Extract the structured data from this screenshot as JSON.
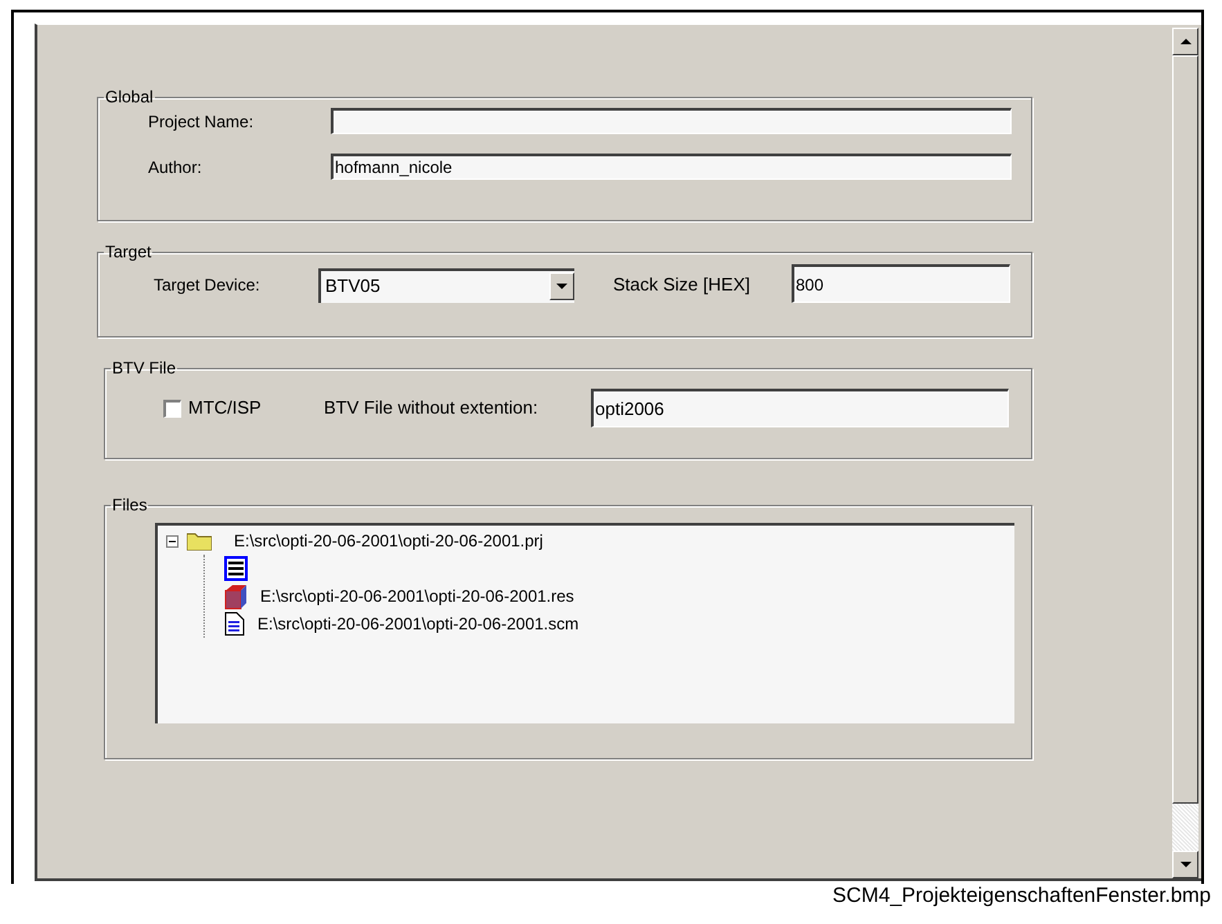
{
  "global": {
    "legend": "Global",
    "project_name": {
      "label": "Project Name:"
    },
    "author": {
      "label": "Author:",
      "value": "hofmann_nicole"
    }
  },
  "target": {
    "legend": "Target",
    "device": {
      "label": "Target Device:",
      "value": "BTV05"
    },
    "stack_size": {
      "label": "Stack Size [HEX]",
      "value": "800"
    }
  },
  "btv_file": {
    "legend": "BTV File",
    "mtc_isp": {
      "label": "MTC/ISP",
      "checked": false
    },
    "file": {
      "label": "BTV File without extention:",
      "value": "opti2006"
    }
  },
  "files": {
    "legend": "Files",
    "tree": [
      {
        "kind": "folder",
        "label": "E:\\src\\opti-20-06-2001\\opti-20-06-2001.prj",
        "expanded": true,
        "children": [
          {
            "kind": "list"
          },
          {
            "kind": "resource",
            "label": "E:\\src\\opti-20-06-2001\\opti-20-06-2001.res"
          },
          {
            "kind": "document",
            "label": "E:\\src\\opti-20-06-2001\\opti-20-06-2001.scm"
          }
        ]
      }
    ]
  },
  "caption": "SCM4_ProjekteigenschaftenFenster.bmp"
}
